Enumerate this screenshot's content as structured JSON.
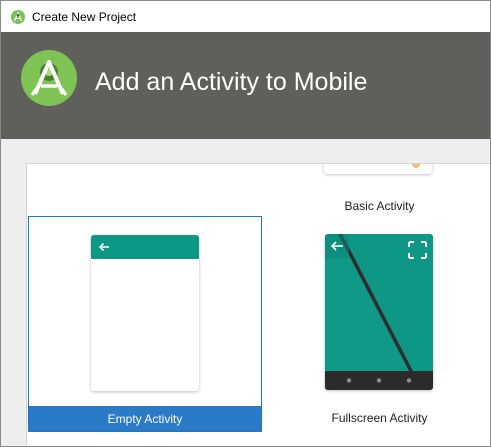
{
  "window": {
    "title": "Create New Project",
    "icon": "android-studio-icon"
  },
  "header": {
    "title": "Add an Activity to Mobile",
    "logo": "android-studio-logo",
    "background": "#5f5f5c"
  },
  "gallery": {
    "selected": "Empty Activity",
    "accent": "#0f9785",
    "selection_color": "#2a7ac8",
    "templates": [
      {
        "label": "Basic Activity"
      },
      {
        "label": "Empty Activity"
      },
      {
        "label": "Fullscreen Activity"
      }
    ]
  }
}
